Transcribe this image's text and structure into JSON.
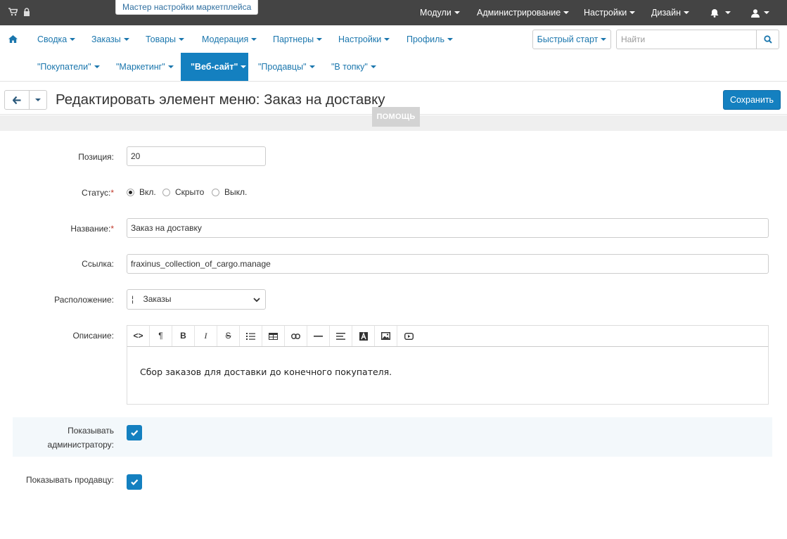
{
  "topbar": {
    "wizard": "Мастер настройки маркетплейса",
    "menu": [
      "Модули",
      "Администрирование",
      "Настройки",
      "Дизайн"
    ],
    "icons": [
      "cart-icon",
      "lock-icon",
      "bell-icon",
      "user-icon"
    ]
  },
  "nav": {
    "items": [
      "Сводка",
      "Заказы",
      "Товары",
      "Модерация",
      "Партнеры",
      "Настройки",
      "Профиль"
    ],
    "subitems": [
      "\"Покупатели\"",
      "\"Маркетинг\"",
      "\"Веб-сайт\"",
      "\"Продавцы\"",
      "\"В топку\""
    ],
    "quick_start": "Быстрый старт",
    "search_placeholder": "Найти"
  },
  "title": {
    "text": "Редактировать элемент меню: Заказ на доставку",
    "save": "Сохранить",
    "help": "ПОМОЩЬ"
  },
  "form": {
    "position_label": "Позиция:",
    "position_value": "20",
    "status_label": "Статус:",
    "status_options": [
      "Вкл.",
      "Скрыто",
      "Выкл."
    ],
    "status_selected": "Вкл.",
    "name_label": "Название:",
    "name_value": "Заказ на доставку",
    "link_label": "Ссылка:",
    "link_value": "fraxinus_collection_of_cargo.manage",
    "location_label": "Расположение:",
    "location_value": "¦    Заказы",
    "description_label": "Описание:",
    "description_text": "Сбор заказов для доставки до конечного покупателя.",
    "show_admin_label_1": "Показывать",
    "show_admin_label_2": "администратору:",
    "show_admin_checked": true,
    "show_vendor_label": "Показывать продавцу:",
    "show_vendor_checked": true
  },
  "colors": {
    "accent": "#1480c0",
    "topbar": "#444444",
    "link": "#1a76ad"
  }
}
